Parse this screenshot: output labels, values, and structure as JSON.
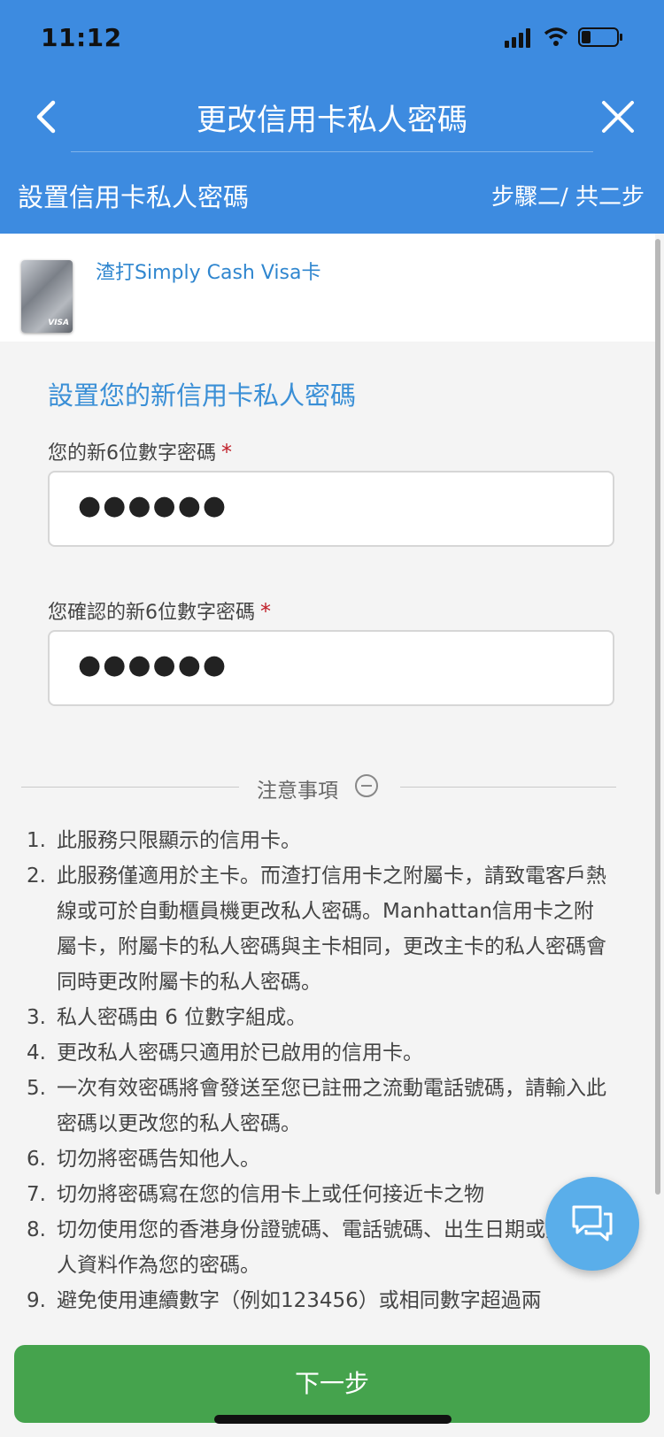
{
  "status_bar": {
    "time": "11:12"
  },
  "header": {
    "title": "更改信用卡私人密碼",
    "subtitle": "設置信用卡私人密碼",
    "step": "步驟二/ 共二步"
  },
  "card": {
    "name": "渣打Simply Cash Visa卡",
    "brand": "VISA"
  },
  "form": {
    "section_title": "設置您的新信用卡私人密碼",
    "new_pin": {
      "label": "您的新6位數字密碼",
      "required_mark": "*",
      "value": "●●●●●●"
    },
    "confirm_pin": {
      "label": "您確認的新6位數字密碼",
      "required_mark": "*",
      "value": "●●●●●●"
    }
  },
  "notice": {
    "title": "注意事項",
    "items": [
      {
        "num": "1.",
        "text": "此服務只限顯示的信用卡。"
      },
      {
        "num": "2.",
        "text": "此服務僅適用於主卡。而渣打信用卡之附屬卡，請致電客戶熱線或可於自動櫃員機更改私人密碼。Manhattan信用卡之附屬卡，附屬卡的私人密碼與主卡相同，更改主卡的私人密碼會同時更改附屬卡的私人密碼。"
      },
      {
        "num": "3.",
        "text": "私人密碼由 6 位數字組成。"
      },
      {
        "num": "4.",
        "text": "更改私人密碼只適用於已啟用的信用卡。"
      },
      {
        "num": "5.",
        "text": "一次有效密碼將會發送至您已註冊之流動電話號碼，請輸入此密碼以更改您的私人密碼。"
      },
      {
        "num": "6.",
        "text": "切勿將密碼告知他人。"
      },
      {
        "num": "7.",
        "text": "切勿將密碼寫在您的信用卡上或任何接近卡之物"
      },
      {
        "num": "8.",
        "text": "切勿使用您的香港身份證號碼、電話號碼、出生日期或其他個人資料作為您的密碼。"
      },
      {
        "num": "9.",
        "text": "避免使用連續數字（例如123456）或相同數字超過兩"
      }
    ]
  },
  "buttons": {
    "next": "下一步"
  },
  "colors": {
    "header_bg": "#3d8be0",
    "accent": "#3a8fd6",
    "next_bg": "#45a34d",
    "chat_bg": "#5aaeea",
    "required": "#c0202a"
  },
  "icons": [
    "back-arrow-icon",
    "close-icon",
    "minus-circle-icon",
    "chat-icon",
    "signal-icon",
    "wifi-icon",
    "battery-icon"
  ]
}
